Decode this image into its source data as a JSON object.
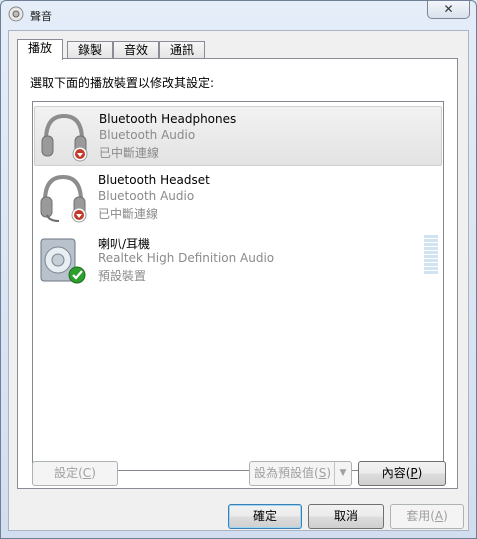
{
  "window": {
    "title": "聲音",
    "close_glyph": "✕"
  },
  "tabs": [
    {
      "label": "播放",
      "active": true
    },
    {
      "label": "錄製",
      "active": false
    },
    {
      "label": "音效",
      "active": false
    },
    {
      "label": "通訊",
      "active": false
    }
  ],
  "instruction": "選取下面的播放裝置以修改其設定:",
  "devices": [
    {
      "name": "Bluetooth Headphones",
      "description": "Bluetooth Audio",
      "status": "已中斷連線",
      "icon": "headphones-icon",
      "badge": "disconnected-badge",
      "selected": true
    },
    {
      "name": "Bluetooth Headset",
      "description": "Bluetooth Audio",
      "status": "已中斷連線",
      "icon": "headset-icon",
      "badge": "disconnected-badge",
      "selected": false
    },
    {
      "name": "喇叭/耳機",
      "description": "Realtek High Definition Audio",
      "status": "預設裝置",
      "icon": "speaker-icon",
      "badge": "default-check-badge",
      "selected": false
    }
  ],
  "buttons": {
    "configure": {
      "label": "設定(",
      "key": "C",
      "suffix": ")"
    },
    "set_default": {
      "label": "設為預設值(",
      "key": "S",
      "suffix": ")"
    },
    "properties": {
      "label": "內容(",
      "key": "P",
      "suffix": ")"
    },
    "ok": "確定",
    "cancel": "取消",
    "apply": {
      "label": "套用(",
      "key": "A",
      "suffix": ")"
    }
  },
  "colors": {
    "selection": "#e6e6e6",
    "disconnected": "#c0392b",
    "default_check": "#2e9e2e"
  }
}
